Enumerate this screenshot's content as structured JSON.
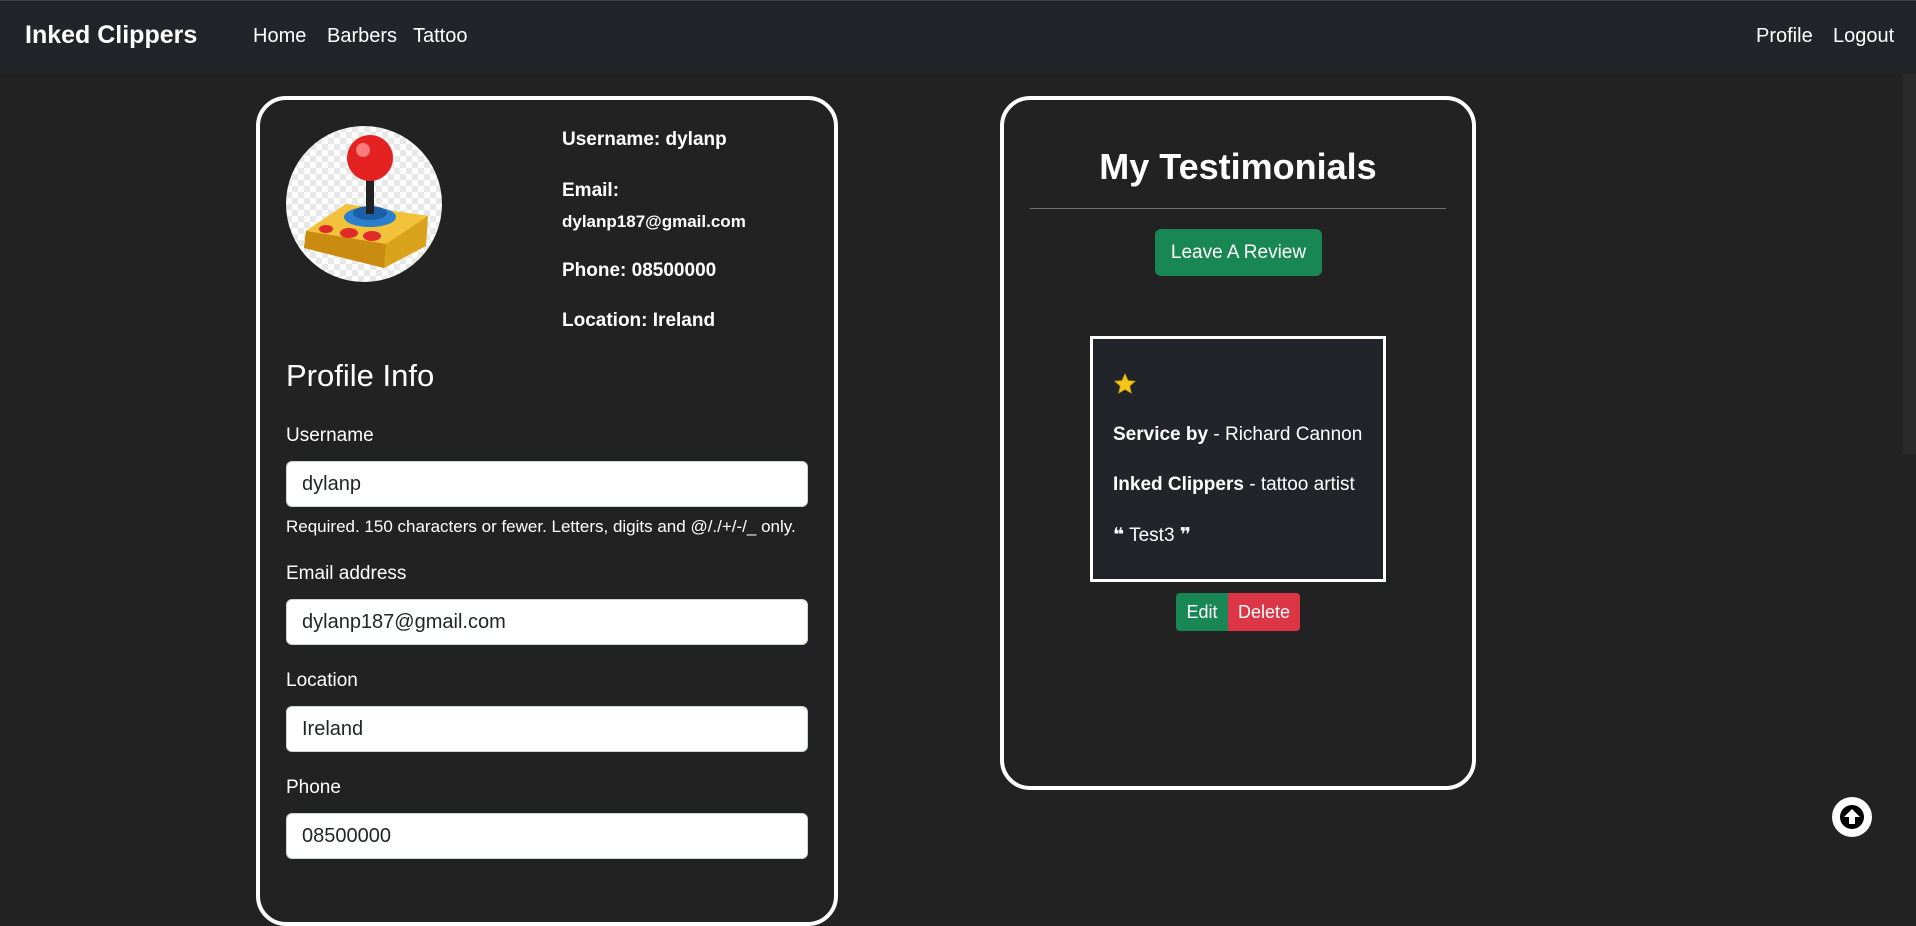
{
  "navbar": {
    "brand": "Inked Clippers",
    "left_links": [
      "Home",
      "Barbers",
      "Tattoo"
    ],
    "right_links": [
      "Profile",
      "Logout"
    ]
  },
  "profile_summary": {
    "username": "Username: dylanp",
    "email_label": "Email:",
    "email": "dylanp187@gmail.com",
    "phone": "Phone: 08500000",
    "location": "Location: Ireland",
    "avatar_icon": "joystick-icon"
  },
  "profile_form": {
    "title": "Profile Info",
    "username_label": "Username",
    "username_value": "dylanp",
    "username_help": "Required. 150 characters or fewer. Letters, digits and @/./+/-/_ only.",
    "email_label": "Email address",
    "email_value": "dylanp187@gmail.com",
    "location_label": "Location",
    "location_value": "Ireland",
    "phone_label": "Phone",
    "phone_value": "08500000"
  },
  "testimonials": {
    "title": "My Testimonials",
    "leave_review_label": "Leave A Review",
    "review": {
      "rating_stars": 1,
      "service_by_label": "Service by",
      "service_by_value": "Richard Cannon",
      "shop_label": "Inked Clippers",
      "shop_value": "tattoo artist",
      "quote": "Test3"
    },
    "edit_label": "Edit",
    "delete_label": "Delete"
  },
  "colors": {
    "background": "#222222",
    "navbar": "#212529",
    "success": "#198754",
    "danger": "#dc3545",
    "star": "#f5c518"
  }
}
